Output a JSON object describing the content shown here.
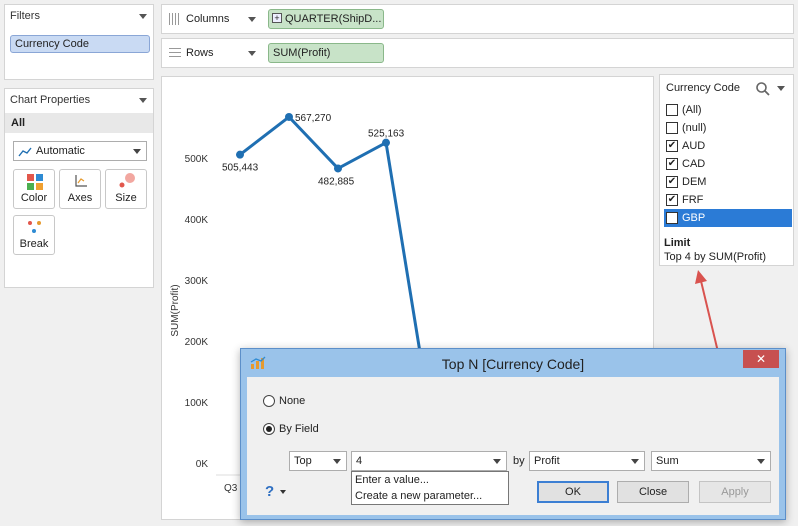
{
  "filters": {
    "title": "Filters",
    "pill": "Currency Code"
  },
  "chart_props": {
    "title": "Chart Properties",
    "all_label": "All",
    "mark_type": "Automatic",
    "cards": [
      "Color",
      "Axes",
      "Size",
      "Break"
    ]
  },
  "shelves": {
    "columns_label": "Columns",
    "columns_pill": "QUARTER(ShipD...",
    "rows_label": "Rows",
    "rows_pill": "SUM(Profit)"
  },
  "chart_data": {
    "type": "line",
    "ylabel": "SUM(Profit)",
    "yticks": [
      "500K",
      "400K",
      "300K",
      "200K",
      "100K",
      "0K"
    ],
    "xtick_partial": "Q3 1",
    "points": [
      505443,
      567270,
      482885,
      525163
    ],
    "point_labels": [
      "505,443",
      "567,270",
      "482,885",
      "525,163"
    ],
    "ylim": [
      0,
      600000
    ],
    "color": "#1f6fb2"
  },
  "quick_filter": {
    "title": "Currency Code",
    "items": [
      {
        "label": "(All)",
        "checked": false
      },
      {
        "label": "(null)",
        "checked": false
      },
      {
        "label": "AUD",
        "checked": true
      },
      {
        "label": "CAD",
        "checked": true
      },
      {
        "label": "DEM",
        "checked": true
      },
      {
        "label": "FRF",
        "checked": true
      },
      {
        "label": "GBP",
        "checked": true,
        "selected": true
      }
    ],
    "limit_title": "Limit",
    "limit_text": "Top 4 by SUM(Profit)"
  },
  "dialog": {
    "title": "Top N [Currency Code]",
    "close": "✕",
    "none_label": "None",
    "byfield_label": "By Field",
    "top_value": "Top",
    "count_value": "4",
    "by_label": "by",
    "field_value": "Profit",
    "agg_value": "Sum",
    "dropdown_items": [
      "Enter a value...",
      "Create a new parameter..."
    ],
    "help": "?",
    "ok": "OK",
    "close_btn": "Close",
    "apply": "Apply"
  },
  "accent": "#2b7bd6",
  "arrow_color": "#d9534f"
}
